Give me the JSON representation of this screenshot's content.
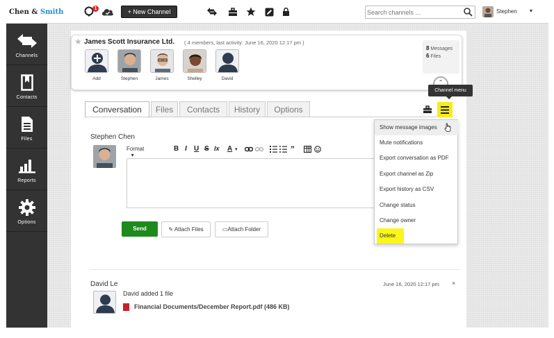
{
  "brand": {
    "part1": "Chen &",
    "part2": "Smith"
  },
  "topbar": {
    "notification_count": "1",
    "new_channel_label": "+ New Channel",
    "search_placeholder": "Search channels ...",
    "user_name": "Stephen",
    "user_caret": "▾"
  },
  "sidebar": {
    "items": [
      {
        "label": "Channels",
        "icon": "arrows-icon"
      },
      {
        "label": "Contacts",
        "icon": "bookmark-icon"
      },
      {
        "label": "Files",
        "icon": "file-icon"
      },
      {
        "label": "Reports",
        "icon": "bar-chart-icon"
      },
      {
        "label": "Options",
        "icon": "gear-icon"
      }
    ]
  },
  "channel": {
    "title": "James Scott Insurance Ltd.",
    "meta": "( 4 members, last activity: June 16, 2020 12:17 pm )",
    "members": [
      {
        "name": "Add"
      },
      {
        "name": "Stephen"
      },
      {
        "name": "James"
      },
      {
        "name": "Shelley"
      },
      {
        "name": "David"
      }
    ],
    "stats": {
      "messages_count": "8",
      "messages_label": "Messages",
      "files_count": "6",
      "files_label": "Files"
    },
    "collapse_glyph": "⌃"
  },
  "tabs": [
    {
      "label": "Conversation",
      "active": true
    },
    {
      "label": "Files",
      "active": false
    },
    {
      "label": "Contacts",
      "active": false
    },
    {
      "label": "History",
      "active": false
    },
    {
      "label": "Options",
      "active": false
    }
  ],
  "tooltip": "Channel menu",
  "composer": {
    "author": "Stephen Chen",
    "format_label": "Format",
    "format_caret": "▾",
    "tools": {
      "bold": "B",
      "italic": "I",
      "underline": "U",
      "strike": "S",
      "clear": "Ix",
      "color": "A"
    },
    "send_label": "Send",
    "attach_files_label": "Attach Files",
    "attach_folder_label": "Attach Folder"
  },
  "message": {
    "author": "David Le",
    "time": "June 16, 2020 12:17 pm",
    "close": "×",
    "text": "David added 1 file",
    "file": "Financial Documents/December Report.pdf (486 KB)"
  },
  "menu": {
    "items": [
      "Show message images",
      "Mute notifications",
      "Export conversation as PDF",
      "Export channel as Zip",
      "Export history as CSV",
      "Change status",
      "Change owner",
      "Delete"
    ]
  },
  "colors": {
    "highlight": "#f7ec1b",
    "send": "#1e8a1e",
    "sidebar": "#333333",
    "brand_accent": "#1a8fd8",
    "badge": "#d9232d"
  }
}
